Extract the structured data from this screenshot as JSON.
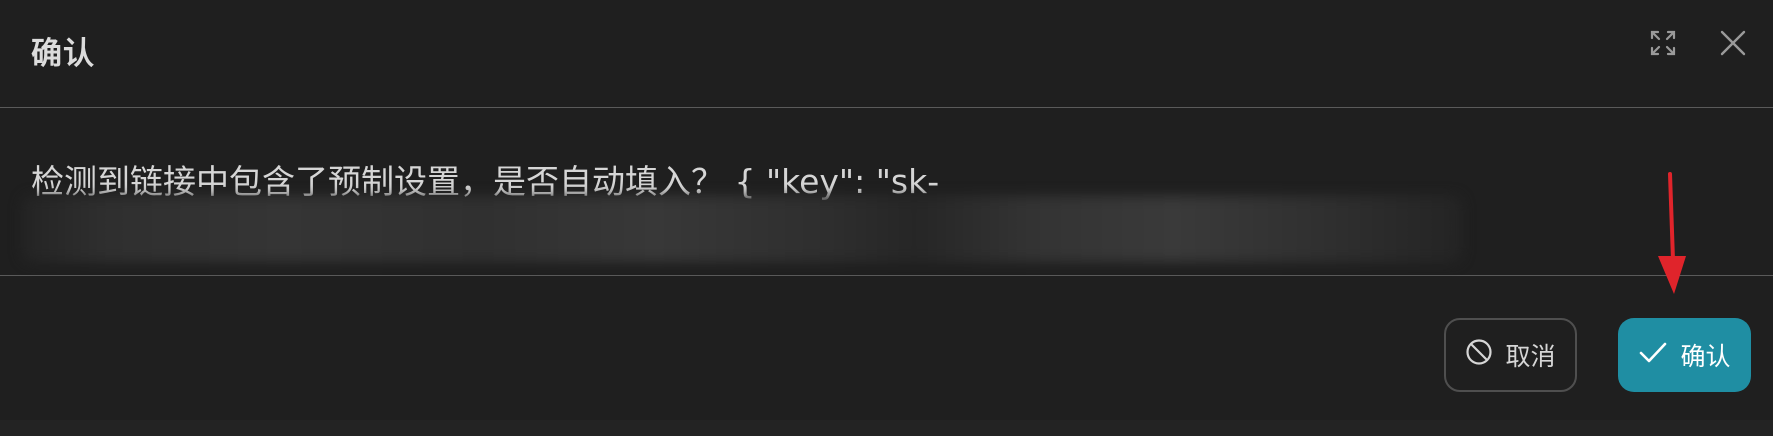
{
  "dialog": {
    "title": "确认",
    "message": "检测到链接中包含了预制设置，是否自动填入？ { \"key\": \"sk-",
    "redacted_note": "",
    "icons": {
      "expand": "expand-icon",
      "close": "close-icon"
    }
  },
  "footer": {
    "cancel_label": "取消",
    "confirm_label": "确认",
    "cancel_icon": "ban-icon",
    "confirm_icon": "check-icon"
  },
  "annotation": {
    "arrow_color": "#e0242b"
  },
  "colors": {
    "background": "#1f1f1f",
    "accent": "#1f8ea3",
    "divider": "#5a5a5a",
    "text": "#d6d6d6"
  }
}
